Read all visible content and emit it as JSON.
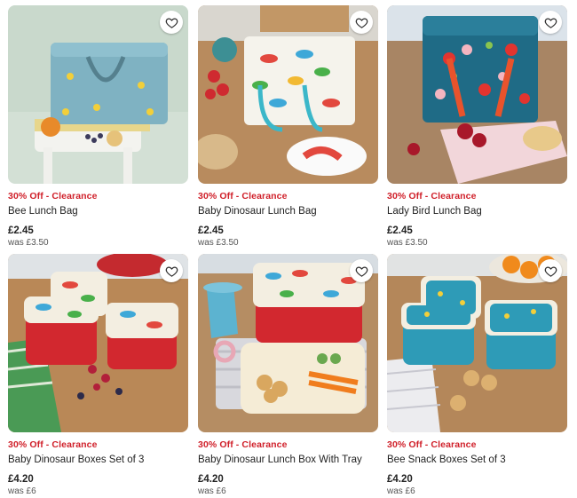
{
  "products": [
    {
      "promo": "30% Off - Clearance",
      "title": "Bee Lunch Bag",
      "price": "£2.45",
      "was": "was £3.50"
    },
    {
      "promo": "30% Off - Clearance",
      "title": "Baby Dinosaur Lunch Bag",
      "price": "£2.45",
      "was": "was £3.50"
    },
    {
      "promo": "30% Off - Clearance",
      "title": "Lady Bird Lunch Bag",
      "price": "£2.45",
      "was": "was £3.50"
    },
    {
      "promo": "30% Off - Clearance",
      "title": "Baby Dinosaur Boxes Set of 3",
      "price": "£4.20",
      "was": "was £6"
    },
    {
      "promo": "30% Off - Clearance",
      "title": "Baby Dinosaur Lunch Box With Tray",
      "price": "£4.20",
      "was": "was £6"
    },
    {
      "promo": "30% Off - Clearance",
      "title": "Bee Snack Boxes Set of 3",
      "price": "£4.20",
      "was": "was £6"
    }
  ],
  "icons": {
    "favourite": "heart-outline-icon"
  },
  "colors": {
    "promo": "#d0202a",
    "text": "#222222",
    "was": "#555555"
  }
}
